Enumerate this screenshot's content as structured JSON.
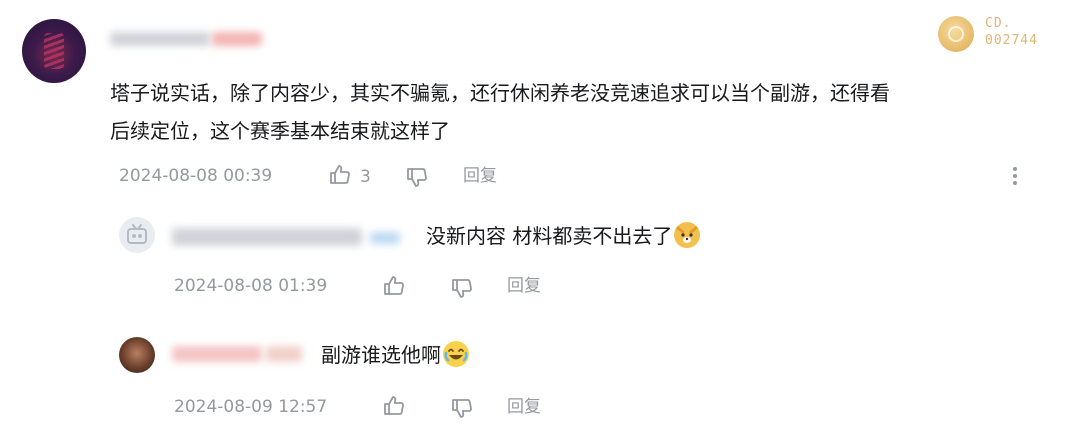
{
  "main_comment": {
    "text_line1": "塔子说实话，除了内容少，其实不骗氪，还行休闲养老没竞速追求可以当个副游，还得看",
    "text_line2": "后续定位，这个赛季基本结束就这样了",
    "timestamp": "2024-08-08 00:39",
    "like_count": "3",
    "reply_label": "回复"
  },
  "badge": {
    "line1": "CD.",
    "line2": "002744",
    "color": "#e0b473"
  },
  "replies": [
    {
      "text": "没新内容 材料都卖不出去了",
      "emoji": "dog-emoji",
      "timestamp": "2024-08-08 01:39",
      "reply_label": "回复"
    },
    {
      "text": "副游谁选他啊",
      "emoji": "laugh-cry-emoji",
      "timestamp": "2024-08-09 12:57",
      "reply_label": "回复"
    }
  ],
  "colors": {
    "text": "#18191c",
    "meta": "#9499a0",
    "background": "#ffffff"
  }
}
